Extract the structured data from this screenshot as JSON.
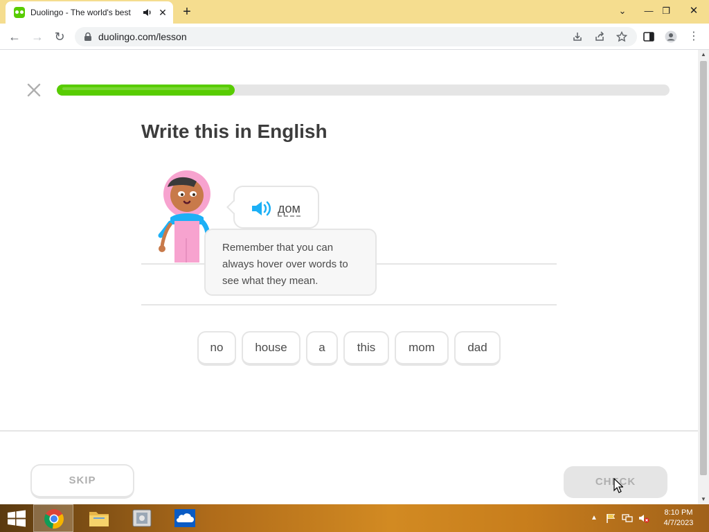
{
  "browser": {
    "tab_title": "Duolingo - The world's best",
    "new_tab_label": "+",
    "url": "duolingo.com/lesson"
  },
  "lesson": {
    "progress": 0.29,
    "heading": "Write this in English",
    "prompt_word": "дом",
    "tooltip": "Remember that you can always hover over words to see what they mean.",
    "word_bank": [
      "no",
      "house",
      "a",
      "this",
      "mom",
      "dad"
    ],
    "skip_label": "SKIP",
    "check_label": "CHECK"
  },
  "colors": {
    "brand_green": "#58cc02",
    "speaker_blue": "#1cb0f6",
    "border_gray": "#e5e5e5",
    "disabled_text": "#afafaf"
  },
  "taskbar": {
    "time": "8:10 PM",
    "date": "4/7/2023"
  }
}
